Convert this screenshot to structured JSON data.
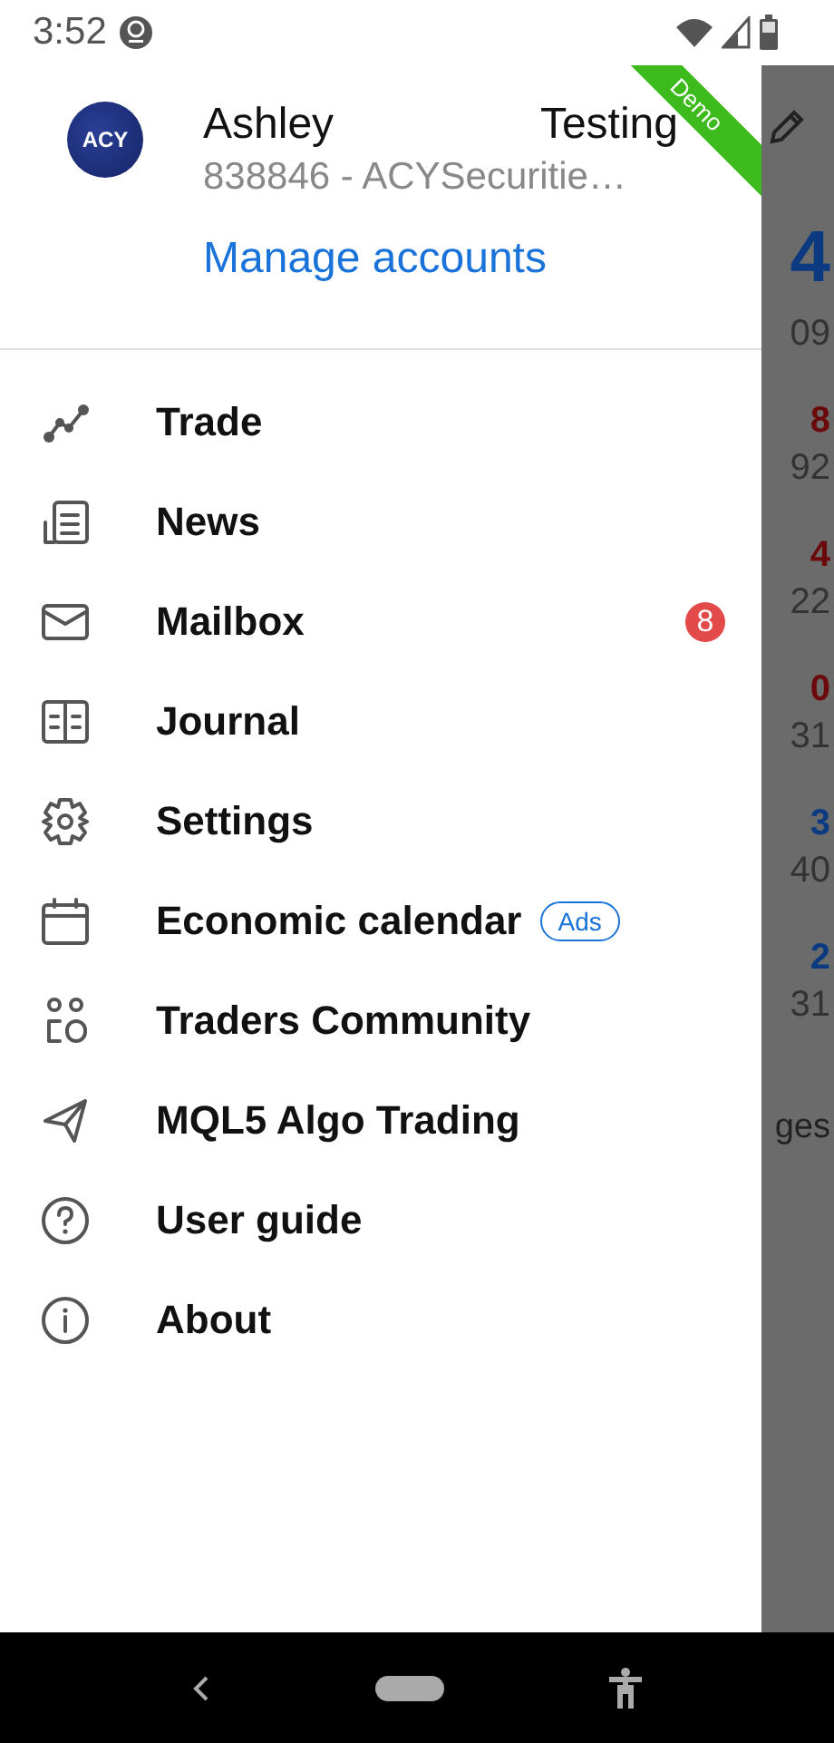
{
  "status_bar": {
    "time": "3:52"
  },
  "account": {
    "logo": "ACY",
    "first_name": "Ashley",
    "last_name": "Testing",
    "account_line": "838846 - ACYSecuritie…",
    "manage_link": "Manage accounts",
    "ribbon": "Demo"
  },
  "menu": [
    {
      "kind": "trade",
      "label": "Trade"
    },
    {
      "kind": "news",
      "label": "News"
    },
    {
      "kind": "mail",
      "label": "Mailbox",
      "badge": "8"
    },
    {
      "kind": "journal",
      "label": "Journal"
    },
    {
      "kind": "settings",
      "label": "Settings"
    },
    {
      "kind": "calendar",
      "label": "Economic calendar",
      "tag": "Ads"
    },
    {
      "kind": "community",
      "label": "Traders Community"
    },
    {
      "kind": "send",
      "label": "MQL5 Algo Trading"
    },
    {
      "kind": "help",
      "label": "User guide"
    },
    {
      "kind": "info",
      "label": "About"
    }
  ],
  "background_fragments": [
    {
      "kind": "big-blue",
      "text": "4"
    },
    {
      "kind": "small",
      "text": "09"
    },
    {
      "kind": "sup-red",
      "text": "8"
    },
    {
      "kind": "small",
      "text": "92"
    },
    {
      "kind": "sup-red",
      "text": "4"
    },
    {
      "kind": "small",
      "text": "22"
    },
    {
      "kind": "sup-red",
      "text": "0"
    },
    {
      "kind": "small",
      "text": "31"
    },
    {
      "kind": "sup-blue",
      "text": "3"
    },
    {
      "kind": "small",
      "text": "40"
    },
    {
      "kind": "sup-blue",
      "text": "2"
    },
    {
      "kind": "small",
      "text": "31"
    },
    {
      "kind": "label",
      "text": "ges"
    }
  ]
}
